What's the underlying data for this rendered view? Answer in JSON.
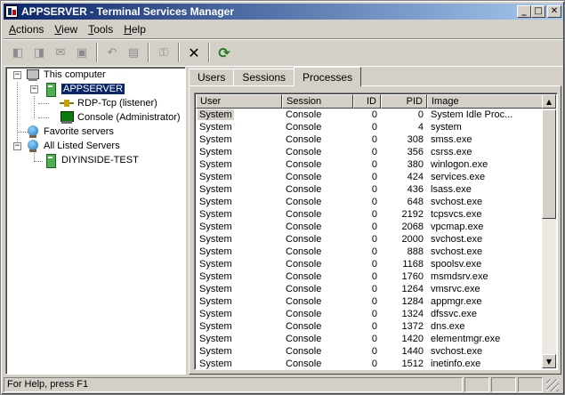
{
  "window": {
    "title": "APPSERVER - Terminal Services Manager",
    "controls": {
      "minimize": "_",
      "maximize": "□",
      "close": "✕"
    }
  },
  "menu": [
    {
      "label": "Actions"
    },
    {
      "label": "View"
    },
    {
      "label": "Tools"
    },
    {
      "label": "Help"
    }
  ],
  "toolbar": {
    "buttons": [
      {
        "icon": "connect-icon",
        "glyph": "◧"
      },
      {
        "icon": "disconnect-icon",
        "glyph": "◨"
      },
      {
        "icon": "send-message-icon",
        "glyph": "✉"
      },
      {
        "icon": "remote-control-icon",
        "glyph": "▣"
      },
      {
        "icon": "reset-icon",
        "glyph": "↶"
      },
      {
        "icon": "status-icon",
        "glyph": "▤"
      },
      {
        "icon": "logoff-icon",
        "glyph": "⚿"
      },
      {
        "icon": "end-process-icon",
        "glyph": "✕"
      },
      {
        "icon": "refresh-icon",
        "glyph": "⟳"
      }
    ]
  },
  "tree": {
    "this_computer": "This computer",
    "appserver": "APPSERVER",
    "rdp_listener": "RDP-Tcp (listener)",
    "console": "Console (Administrator)",
    "favorite_servers": "Favorite servers",
    "all_listed_servers": "All Listed Servers",
    "diyinside": "DIYINSIDE-TEST"
  },
  "tabs": [
    {
      "label": "Users"
    },
    {
      "label": "Sessions"
    },
    {
      "label": "Processes"
    }
  ],
  "active_tab": "Processes",
  "columns": [
    "User",
    "Session",
    "ID",
    "PID",
    "Image"
  ],
  "processes": [
    {
      "user": "System",
      "session": "Console",
      "id": "0",
      "pid": "0",
      "image": "System Idle Proc..."
    },
    {
      "user": "System",
      "session": "Console",
      "id": "0",
      "pid": "4",
      "image": "system"
    },
    {
      "user": "System",
      "session": "Console",
      "id": "0",
      "pid": "308",
      "image": "smss.exe"
    },
    {
      "user": "System",
      "session": "Console",
      "id": "0",
      "pid": "356",
      "image": "csrss.exe"
    },
    {
      "user": "System",
      "session": "Console",
      "id": "0",
      "pid": "380",
      "image": "winlogon.exe"
    },
    {
      "user": "System",
      "session": "Console",
      "id": "0",
      "pid": "424",
      "image": "services.exe"
    },
    {
      "user": "System",
      "session": "Console",
      "id": "0",
      "pid": "436",
      "image": "lsass.exe"
    },
    {
      "user": "System",
      "session": "Console",
      "id": "0",
      "pid": "648",
      "image": "svchost.exe"
    },
    {
      "user": "System",
      "session": "Console",
      "id": "0",
      "pid": "2192",
      "image": "tcpsvcs.exe"
    },
    {
      "user": "System",
      "session": "Console",
      "id": "0",
      "pid": "2068",
      "image": "vpcmap.exe"
    },
    {
      "user": "System",
      "session": "Console",
      "id": "0",
      "pid": "2000",
      "image": "svchost.exe"
    },
    {
      "user": "System",
      "session": "Console",
      "id": "0",
      "pid": "888",
      "image": "svchost.exe"
    },
    {
      "user": "System",
      "session": "Console",
      "id": "0",
      "pid": "1168",
      "image": "spoolsv.exe"
    },
    {
      "user": "System",
      "session": "Console",
      "id": "0",
      "pid": "1760",
      "image": "msmdsrv.exe"
    },
    {
      "user": "System",
      "session": "Console",
      "id": "0",
      "pid": "1264",
      "image": "vmsrvc.exe"
    },
    {
      "user": "System",
      "session": "Console",
      "id": "0",
      "pid": "1284",
      "image": "appmgr.exe"
    },
    {
      "user": "System",
      "session": "Console",
      "id": "0",
      "pid": "1324",
      "image": "dfssvc.exe"
    },
    {
      "user": "System",
      "session": "Console",
      "id": "0",
      "pid": "1372",
      "image": "dns.exe"
    },
    {
      "user": "System",
      "session": "Console",
      "id": "0",
      "pid": "1420",
      "image": "elementmgr.exe"
    },
    {
      "user": "System",
      "session": "Console",
      "id": "0",
      "pid": "1440",
      "image": "svchost.exe"
    },
    {
      "user": "System",
      "session": "Console",
      "id": "0",
      "pid": "1512",
      "image": "inetinfo.exe"
    }
  ],
  "scrollbar": {
    "up": "▲",
    "down": "▼"
  },
  "status": {
    "text": "For Help, press F1"
  }
}
